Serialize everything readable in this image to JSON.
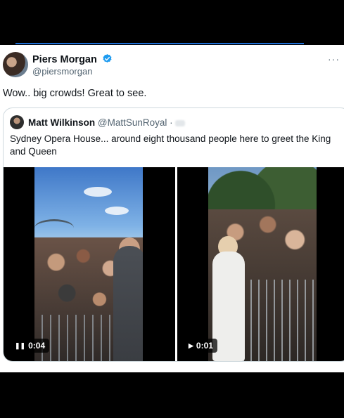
{
  "tweet": {
    "author_name": "Piers Morgan",
    "author_handle": "@piersmorgan",
    "text": "Wow.. big crowds! Great to see.",
    "more_label": "···",
    "verified_icon": "verified-badge-icon"
  },
  "quote": {
    "author_name": "Matt Wilkinson",
    "author_handle": "@MattSunRoyal",
    "separator": "·",
    "text": "Sydney Opera House... around eight thousand people here to greet the King and Queen"
  },
  "media": [
    {
      "icon": "pause-icon",
      "glyph": "❚❚",
      "duration": "0:04"
    },
    {
      "icon": "play-icon",
      "glyph": "▶",
      "duration": "0:01"
    }
  ],
  "colors": {
    "verified": "#1d9bf0",
    "text": "#0f1419",
    "secondary": "#536471",
    "border": "#cfd9de"
  }
}
